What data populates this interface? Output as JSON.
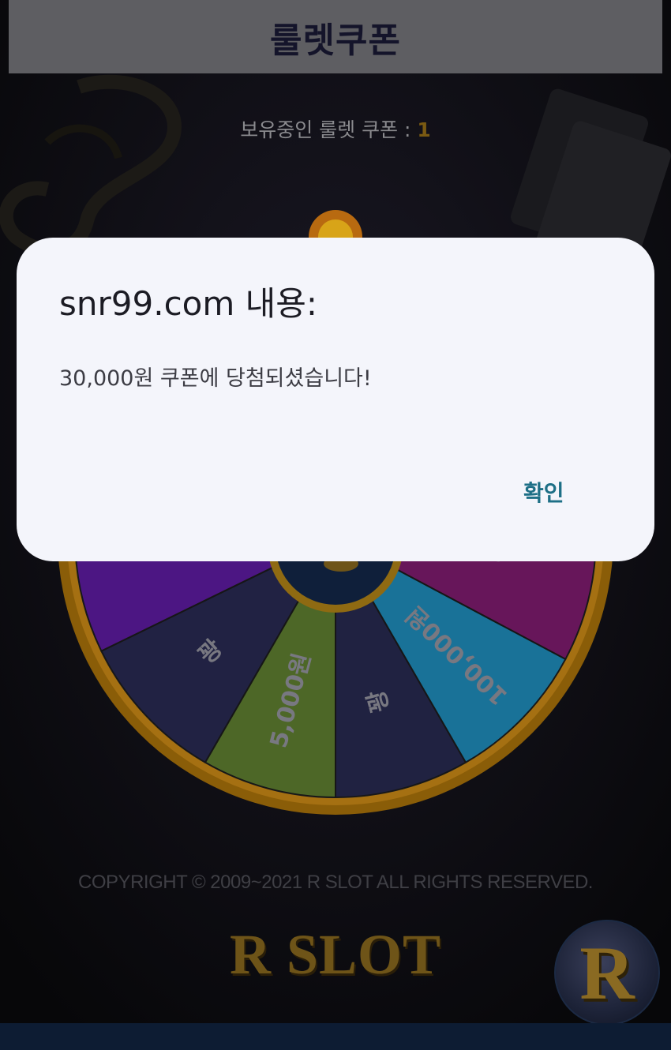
{
  "page": {
    "title": "룰렛쿠폰",
    "coupon_label": "보유중인 룰렛 쿠폰 : ",
    "coupon_count": "1"
  },
  "wheel": {
    "segments": [
      {
        "label": "꽝",
        "color": "#27294f"
      },
      {
        "label": "5,000원",
        "color": "#5b7a2e"
      },
      {
        "label": "꽝",
        "color": "#26284d"
      },
      {
        "label": "100,000원",
        "color": "#1e86b3"
      },
      {
        "label": "꽝",
        "color": "#7a1a6a"
      },
      {
        "label": "",
        "color": "#5a1a9a"
      }
    ]
  },
  "footer": {
    "copyright": "COPYRIGHT © 2009~2021 R SLOT ALL RIGHTS RESERVED.",
    "logo": "R SLOT",
    "fab_letter": "R"
  },
  "dialog": {
    "title": "snr99.com 내용:",
    "message": "30,000원 쿠폰에 당첨되셨습니다!",
    "ok_label": "확인"
  },
  "colors": {
    "dialog_bg": "#f4f5fb",
    "ok_accent": "#1d6f86",
    "coupon_count": "#c9962a"
  }
}
